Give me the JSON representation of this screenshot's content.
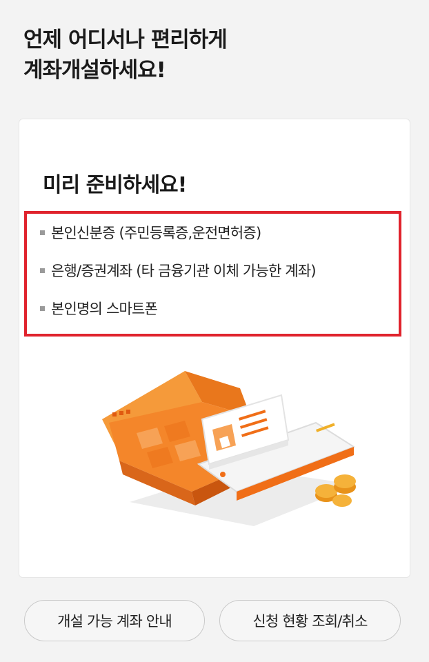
{
  "headline": {
    "line1": "언제 어디서나 편리하게",
    "line2": "계좌개설하세요!"
  },
  "card": {
    "title": "미리 준비하세요!",
    "requirements": [
      "본인신분증 (주민등록증,운전면허증)",
      "은행/증권계좌 (타 금융기관 이체 가능한 계좌)",
      "본인명의 스마트폰"
    ]
  },
  "buttons": {
    "account_guide": "개설 가능 계좌 안내",
    "status_check": "신청 현황 조회/취소"
  },
  "colors": {
    "accent_orange": "#f27a1a",
    "highlight_red": "#e0232d",
    "background": "#f3f3f3"
  }
}
